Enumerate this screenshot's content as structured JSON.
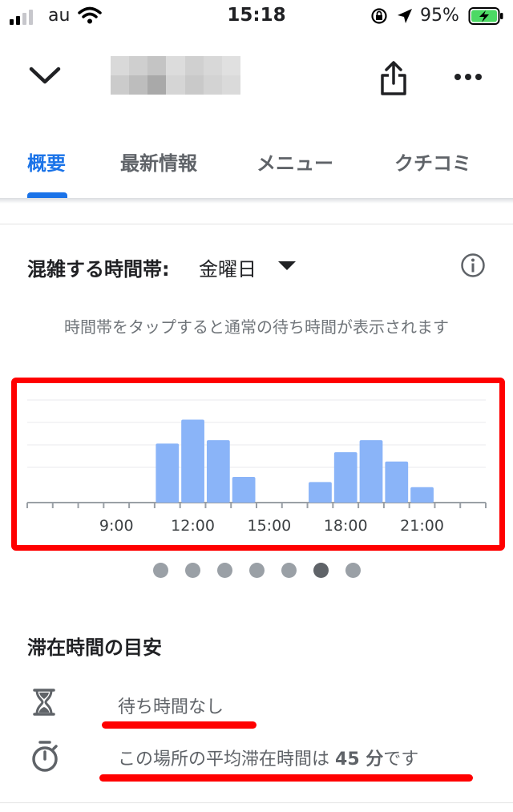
{
  "status_bar": {
    "carrier": "au",
    "time": "15:18",
    "battery": "95%"
  },
  "header": {
    "back_icon": "chevron-down-icon",
    "share_icon": "share-icon",
    "more_icon": "more-horizontal-icon"
  },
  "tabs": [
    {
      "label": "概要",
      "active": true
    },
    {
      "label": "最新情報",
      "active": false
    },
    {
      "label": "メニュー",
      "active": false
    },
    {
      "label": "クチコミ",
      "active": false
    }
  ],
  "popular_times": {
    "title": "混雑する時間帯:",
    "day": "金曜日",
    "hint": "時間帯をタップすると通常の待ち時間が表示されます",
    "page_count": 7,
    "active_page": 5
  },
  "chart_data": {
    "type": "bar",
    "x_tick_labels": [
      "9:00",
      "12:00",
      "15:00",
      "18:00",
      "21:00"
    ],
    "hours": [
      6,
      7,
      8,
      9,
      10,
      11,
      12,
      13,
      14,
      15,
      16,
      17,
      18,
      19,
      20,
      21,
      22,
      23
    ],
    "values": [
      0,
      0,
      0,
      0,
      0,
      69,
      97,
      73,
      30,
      0,
      0,
      24,
      59,
      73,
      48,
      18,
      0,
      0
    ],
    "ylim": [
      0,
      120
    ],
    "color": "#8ab4f8",
    "grid": true
  },
  "stay": {
    "title": "滞在時間の目安",
    "wait_text": "待ち時間なし",
    "avg_prefix": "この場所の平均滞在時間は",
    "avg_value": "45 分",
    "avg_suffix": "です"
  },
  "annotation_color": "#ff0000"
}
